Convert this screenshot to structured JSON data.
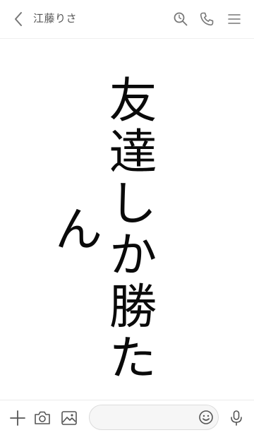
{
  "header": {
    "title": "江藤りさ",
    "icons": {
      "back": "chevron-left-icon",
      "search": "search-icon",
      "call": "phone-icon",
      "menu": "menu-icon"
    }
  },
  "content": {
    "vertical_text": "友達しか勝たん"
  },
  "bottom_bar": {
    "message_value": "",
    "message_placeholder": "",
    "icons": {
      "plus": "plus-icon",
      "camera": "camera-icon",
      "image": "image-icon",
      "emoji": "emoji-icon",
      "mic": "microphone-icon"
    }
  },
  "colors": {
    "background": "#ffffff",
    "icon_gray": "#777777",
    "text_black": "#0a0a0a"
  }
}
